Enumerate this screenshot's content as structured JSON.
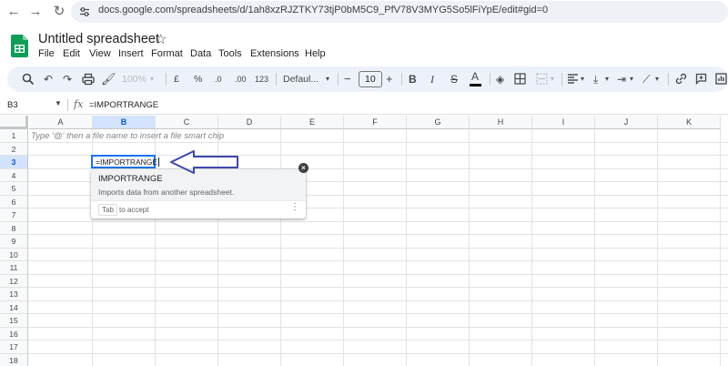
{
  "browser": {
    "back_glyph": "←",
    "forward_glyph": "→",
    "reload_glyph": "↻",
    "url": "docs.google.com/spreadsheets/d/1ah8xzRJZTKY73tjP0bM5C9_PfV78V3MYG5So5lFiYpE/edit#gid=0"
  },
  "app": {
    "title": "Untitled spreadsheet",
    "star_glyph": "☆",
    "brand_color": "#0f9d58"
  },
  "menu": {
    "items": [
      "File",
      "Edit",
      "View",
      "Insert",
      "Format",
      "Data",
      "Tools",
      "Extensions",
      "Help"
    ]
  },
  "toolbar": {
    "zoom": "100%",
    "currency": "£",
    "percent": "%",
    "decrease_decimals": ".0",
    "increase_decimals": ".00",
    "more_formats": "123",
    "font": "Defaul...",
    "font_size": "10",
    "minus": "−",
    "plus": "+",
    "bold": "B",
    "italic": "I",
    "strikethrough": "S",
    "text_color": "A"
  },
  "formula_bar": {
    "cell_ref": "B3",
    "fx": "fx",
    "formula": "=IMPORTRANGE"
  },
  "grid": {
    "columns": [
      "A",
      "B",
      "C",
      "D",
      "E",
      "F",
      "G",
      "H",
      "I",
      "J",
      "K"
    ],
    "selected_column": "B",
    "rows": [
      "1",
      "2",
      "3",
      "4",
      "5",
      "6",
      "7",
      "8",
      "9",
      "10",
      "11",
      "12",
      "13",
      "14",
      "15",
      "16",
      "17",
      "18"
    ],
    "selected_row": "3",
    "hint": "Type '@' then a file name to insert a file smart chip",
    "active_cell_text": "=IMPORTRANGE"
  },
  "autocomplete": {
    "function_name": "IMPORTRANGE",
    "description": "Imports data from another spreadsheet.",
    "tab_key": "Tab",
    "accept_text": "to accept",
    "more_glyph": "⋮",
    "close_glyph": "×"
  },
  "annotation": {
    "arrow_color": "#3f48a8"
  }
}
